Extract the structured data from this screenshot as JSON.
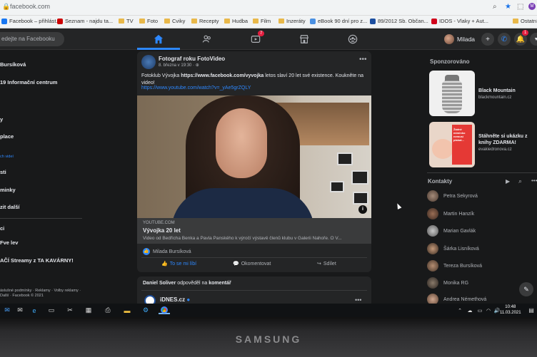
{
  "browser": {
    "url": "facebook.com",
    "bookmarks": [
      {
        "label": "Facebook – přihlást...",
        "icon": "facebook-icon",
        "color": "#1877f2"
      },
      {
        "label": "Seznam - najdu ta...",
        "icon": "seznam-icon",
        "color": "#cc0000"
      },
      {
        "label": "TV",
        "icon": "folder-icon"
      },
      {
        "label": "Foto",
        "icon": "folder-icon"
      },
      {
        "label": "Cviky",
        "icon": "folder-icon"
      },
      {
        "label": "Recepty",
        "icon": "folder-icon"
      },
      {
        "label": "Hudba",
        "icon": "folder-icon"
      },
      {
        "label": "Film",
        "icon": "folder-icon"
      },
      {
        "label": "Inzeráty",
        "icon": "folder-icon"
      },
      {
        "label": "eBook 90 dní pro z...",
        "icon": "ebook-icon",
        "color": "#4a90e2"
      },
      {
        "label": "89/2012 Sb. Občan...",
        "icon": "z-icon",
        "color": "#1c4fa0"
      },
      {
        "label": "IDOS - Vlaky + Aut...",
        "icon": "idos-icon",
        "color": "#d0021b"
      },
      {
        "label": "Ostatní",
        "icon": "folder-icon"
      }
    ]
  },
  "header": {
    "search_placeholder": "edejte na Facebooku",
    "watch_badge": "7",
    "user_name": "Milada",
    "notif_badge": "1"
  },
  "left_sidebar": {
    "items": [
      {
        "label": "Bursíková"
      },
      {
        "label": "19 Informační centrum"
      },
      {
        "label": "y"
      },
      {
        "label": "place"
      },
      {
        "label": "ch videí",
        "small": true
      },
      {
        "label": "sti"
      },
      {
        "label": "minky"
      },
      {
        "label": "zit další"
      },
      {
        "label": "ci"
      },
      {
        "label": "Fve lev"
      },
      {
        "label": "AČÍ Streamy z TA KAVÁRNY!"
      }
    ],
    "footer": "áslušné podmínky · Reklamy · Volby reklamy · Další · Facebook © 2021"
  },
  "post": {
    "page_name": "Fotograf roku FotoVideo",
    "meta": "8. března v 19:30 · ⊕",
    "text_before_link": "Fotoklub Vývojka ",
    "text_link": "https://www.facebook.com/vyvojka",
    "text_after_link": "  letos slaví 20 let své existence. Koukněte na video!",
    "youtube_link": "https://www.youtube.com/watch?v=_yAe5grZQLY",
    "link_domain": "YOUTUBE.COM",
    "link_title": "Vývojka 20 let",
    "link_desc": "Video od Bedřicha Benka a Pavla Panského k výročí výstavě členů klubu v Galerii Nahoře. O V...",
    "reactor": "Milada Bursíková",
    "like_label": "To se mi líbí",
    "comment_label": "Okomentovat",
    "share_label": "Sdílet"
  },
  "post2": {
    "author": "Daniel Soliver",
    "text": " odpověděl na ",
    "target": "komentář",
    "page_name": "iDNES.cz"
  },
  "right": {
    "sponsored_title": "Sponzorováno",
    "ads": [
      {
        "title": "Black Mountain",
        "domain": "blackmountain.cz"
      },
      {
        "title": "Stáhněte si ukázku z knihy ZDARMA!",
        "domain": "evakiedronova.cz"
      }
    ],
    "ad2_overlay": "Žádné miminko nemusí plakat...",
    "contacts_title": "Kontakty",
    "contacts": [
      "Petra Sekyrová",
      "Martin Hanzík",
      "Marian Gavlák",
      "Šárka Lisníková",
      "Tereza Bursíková",
      "Monika RG",
      "Andrea Némethová"
    ]
  },
  "taskbar": {
    "time": "10:48",
    "date": "11.03.2021"
  },
  "monitor": {
    "brand": "SAMSUNG"
  }
}
